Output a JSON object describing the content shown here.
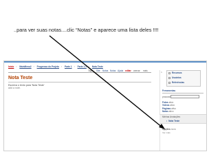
{
  "caption": "..para ver suas notas....clic “Notas” e aparece uma lista deles !!!!",
  "breadcrumb": {
    "items": [
      {
        "label": "Início",
        "home": true
      },
      {
        "label": "MainMenu2"
      },
      {
        "label": "Progresso do Projeto"
      },
      {
        "label": "Parte 1"
      },
      {
        "label": "Parte 1.1"
      },
      {
        "label": "Nota Teste"
      }
    ],
    "separator": "›"
  },
  "page_tabs": {
    "items": [
      {
        "label": "Tags",
        "style": "plain"
      },
      {
        "label": "Site",
        "style": "link"
      },
      {
        "label": "Notas",
        "style": "link"
      },
      {
        "label": "Notas",
        "style": "link"
      },
      {
        "label": "Ajuda",
        "style": "link"
      },
      {
        "label": "editar",
        "style": "edit"
      },
      {
        "label": "anexar",
        "style": "plain"
      },
      {
        "label": "mais",
        "style": "plain"
      }
    ]
  },
  "page": {
    "title": "Nota Teste",
    "body_lines": [
      "Escreva o texto para 'Nota Teste'",
      "add a note."
    ]
  },
  "sidebar": {
    "tab_label": "1",
    "menu_items": [
      "Recursos",
      "Usuários",
      "Referências"
    ],
    "tools_heading": "Ferramentas",
    "search_label": "procurar",
    "links": [
      {
        "label": "Fotos",
        "value": "ativo"
      },
      {
        "label": "Vídeos",
        "value": "ativo"
      },
      {
        "label": "Páginas",
        "value": "ativo"
      },
      {
        "label": "Notas",
        "value": "ativo"
      }
    ],
    "recent_label": "Minhas Anotações",
    "recent_item": "Nota Teste",
    "options_label": "Opções",
    "options_value": "nova",
    "options_sub": "Ver mais"
  },
  "colors": {
    "title": "#b24000",
    "link": "#2a4f8a",
    "edit": "#c00000",
    "pointer_line": "#000000",
    "topline": "#5a8fc8"
  }
}
